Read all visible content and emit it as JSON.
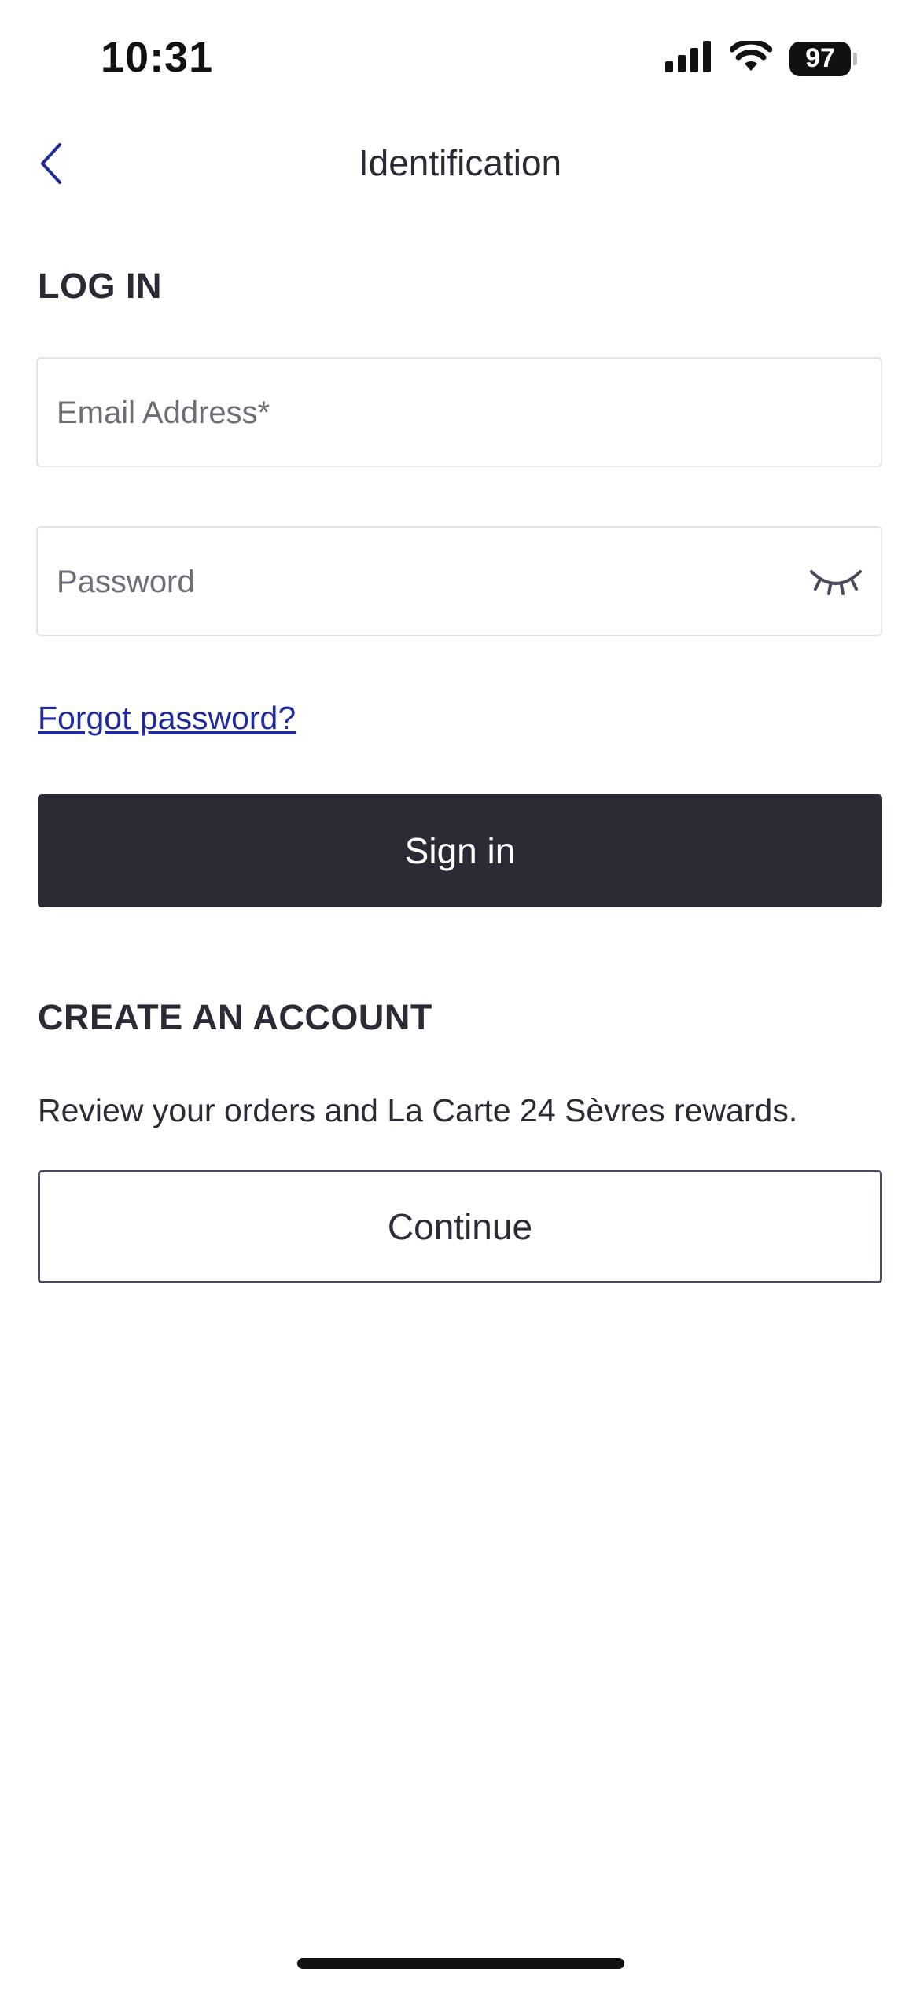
{
  "status_bar": {
    "time": "10:31",
    "battery_level": "97",
    "icons": [
      "cellular-signal-icon",
      "wifi-icon",
      "battery-icon"
    ]
  },
  "header": {
    "title": "Identification",
    "back_icon": "chevron-left-icon"
  },
  "login": {
    "heading": "LOG IN",
    "email": {
      "value": "",
      "placeholder": "Email Address*"
    },
    "password": {
      "value": "",
      "placeholder": "Password",
      "toggle_icon": "eye-closed-icon"
    },
    "forgot_password": "Forgot password?",
    "sign_in_label": "Sign in"
  },
  "create_account": {
    "heading": "CREATE AN ACCOUNT",
    "description": "Review your orders and La Carte 24 Sèvres rewards.",
    "continue_label": "Continue"
  },
  "colors": {
    "primary_dark": "#2b2b36",
    "link": "#1f2b9e",
    "field_border": "#e3e3e6",
    "placeholder": "#6e6e78",
    "background": "#ffffff"
  }
}
